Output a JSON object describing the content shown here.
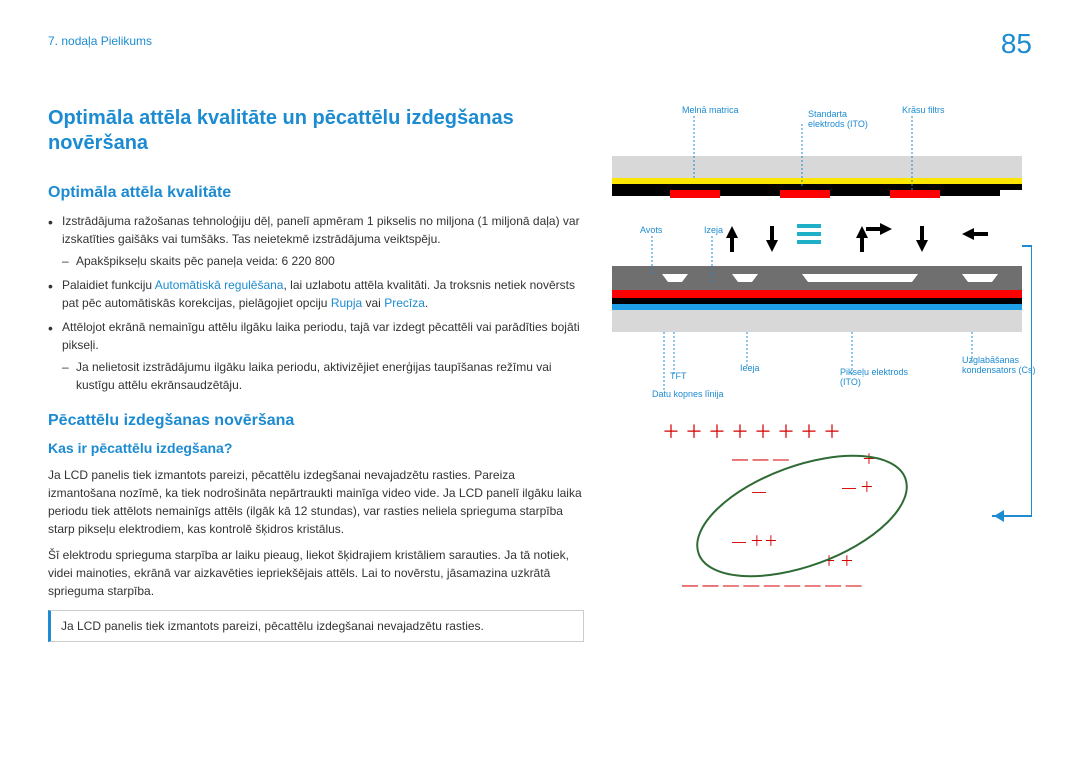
{
  "header": {
    "breadcrumb": "7. nodaļa Pielikums",
    "page_number": "85"
  },
  "main": {
    "title": "Optimāla attēla kvalitāte un pēcattēlu izdegšanas novēršana",
    "section1": {
      "heading": "Optimāla attēla kvalitāte",
      "bullet1_a": "Izstrādājuma ražošanas tehnoloģiju dēļ, panelī apmēram 1 pikselis no miljona (1 miljonā daļa) var izskatīties gaišāks vai tumšāks. Tas neietekmē izstrādājuma veiktspēju.",
      "bullet1_sub": "Apakšpikseļu skaits pēc paneļa veida: 6 220 800",
      "bullet2_a": "Palaidiet funkciju ",
      "bullet2_link1": "Automātiskā regulēšana",
      "bullet2_b": ", lai uzlabotu attēla kvalitāti. Ja troksnis netiek novērsts pat pēc automātiskās korekcijas, pielāgojiet opciju ",
      "bullet2_link2": "Rupja",
      "bullet2_c": " vai ",
      "bullet2_link3": "Precīza",
      "bullet2_d": ".",
      "bullet3": "Attēlojot ekrānā nemainīgu attēlu ilgāku laika periodu, tajā var izdegt pēcattēli vai parādīties bojāti pikseļi.",
      "bullet3_sub": "Ja nelietosit izstrādājumu ilgāku laika periodu, aktivizējiet enerģijas taupīšanas režīmu vai kustīgu attēlu ekrānsaudzētāju."
    },
    "section2": {
      "heading": "Pēcattēlu izdegšanas novēršana",
      "subheading": "Kas ir pēcattēlu izdegšana?",
      "para1": "Ja LCD panelis tiek izmantots pareizi, pēcattēlu izdegšanai nevajadzētu rasties. Pareiza izmantošana nozīmē, ka tiek nodrošināta nepārtraukti mainīga video vide. Ja LCD panelī ilgāku laika periodu tiek attēlots nemainīgs attēls (ilgāk kā 12 stundas), var rasties neliela sprieguma starpība starp pikseļu elektrodiem, kas kontrolē šķidros kristālus.",
      "para2": "Šī elektrodu sprieguma starpība ar laiku pieaug, liekot šķidrajiem kristāliem sarauties. Ja tā notiek, videi mainoties, ekrānā var aizkavēties iepriekšējais attēls. Lai to novērstu, jāsamazina uzkrātā sprieguma starpība.",
      "note": "Ja LCD panelis tiek izmantots pareizi, pēcattēlu izdegšanai nevajadzētu rasties."
    }
  },
  "diagram": {
    "labels": {
      "l1": "Melnā matrica",
      "l2": "Standarta elektrods (ITO)",
      "l3": "Krāsu filtrs",
      "l4": "Avots",
      "l5": "Izeja",
      "l6": "TFT",
      "l7": "Ieeja",
      "l8": "Datu kopnes līnija",
      "l9": "Pikseļu elektrods (ITO)",
      "l10": "Uzglabāšanas kondensators (Cs)"
    }
  }
}
